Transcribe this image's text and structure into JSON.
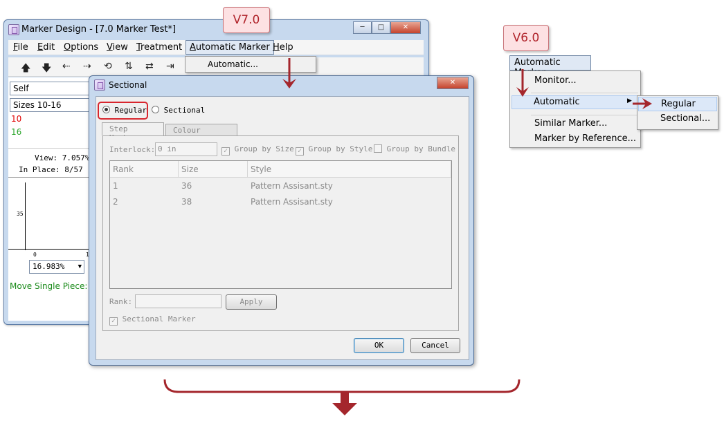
{
  "main_window": {
    "title": "Marker Design - [7.0 Marker Test*]",
    "menus": [
      {
        "label": "File",
        "u": "F",
        "rest": "ile"
      },
      {
        "label": "Edit",
        "u": "E",
        "rest": "dit"
      },
      {
        "label": "Options",
        "u": "O",
        "rest": "ptions"
      },
      {
        "label": "View",
        "u": "V",
        "rest": "iew"
      },
      {
        "label": "Treatment",
        "u": "T",
        "rest": "reatment"
      },
      {
        "label": "Automatic Marker",
        "u": "A",
        "rest": "utomatic Marker"
      },
      {
        "label": "Help",
        "u": "H",
        "rest": "elp"
      }
    ],
    "auto_dropdown_item": "Automatic...",
    "combo_self": "Self",
    "combo_sizes": "Sizes 10-16",
    "size_red": "10",
    "size_green": "16",
    "view_label": "View:",
    "view_value": "7.057%",
    "inplace_label": "In Place:",
    "inplace_value": "8/57",
    "ruler_tick": "35",
    "ruler_zero": "0",
    "ruler_one": "1",
    "zoom_value": "16.983%",
    "status_text": "Move Single Piece:"
  },
  "dialog": {
    "title": "Sectional",
    "radio_regular": "Regular",
    "radio_sectional": "Sectional",
    "tab_step": "Step Marker",
    "tab_colour": "Colour Shading",
    "interlock_label": "Interlock:",
    "interlock_value": "0 in",
    "chk_group_size": "Group by Size",
    "chk_group_style": "Group by Style",
    "chk_group_bundle": "Group by Bundle",
    "columns": [
      "Rank",
      "Size",
      "Style"
    ],
    "rows": [
      {
        "rank": "1",
        "size": "36",
        "style": "Pattern Assisant.sty"
      },
      {
        "rank": "2",
        "size": "38",
        "style": "Pattern Assisant.sty"
      }
    ],
    "rank_label": "Rank:",
    "apply": "Apply",
    "sectional_marker": "Sectional Marker",
    "ok": "OK",
    "cancel": "Cancel"
  },
  "labels": {
    "v7": "V7.0",
    "v6": "V6.0"
  },
  "v6_menu": {
    "menubar": "Automatic Marker",
    "items": [
      "Monitor...",
      "Automatic",
      "Similar Marker...",
      "Marker by Reference..."
    ],
    "submenu": [
      "Regular",
      "Sectional..."
    ]
  },
  "colors": {
    "accent_red": "#b0242b",
    "title_bar": "#c7d9ee",
    "size_red": "#e00000",
    "size_green": "#2aa52a",
    "status_green": "#1a8a1a"
  }
}
